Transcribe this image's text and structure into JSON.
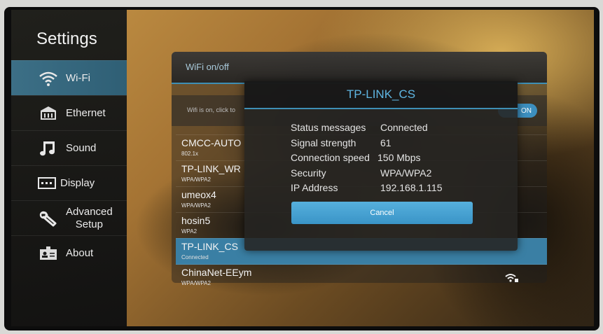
{
  "sidebar": {
    "title": "Settings",
    "items": [
      {
        "label": "Wi-Fi",
        "icon": "wifi-icon",
        "active": true
      },
      {
        "label": "Ethernet",
        "icon": "ethernet-icon"
      },
      {
        "label": "Sound",
        "icon": "music-note-icon"
      },
      {
        "label": "Display",
        "icon": "display-icon"
      },
      {
        "label": "Advanced Setup",
        "line1": "Advanced",
        "line2": "Setup",
        "icon": "wrench-icon"
      },
      {
        "label": "About",
        "icon": "id-card-icon"
      }
    ]
  },
  "wifi_panel": {
    "header": "WiFi on/off",
    "status_text": "Wifi is on, click to",
    "toggle_label": "ON",
    "networks": [
      {
        "name": "CMCC-AUTO",
        "security": "802.1x"
      },
      {
        "name": "TP-LINK_WR",
        "security": "WPA/WPA2"
      },
      {
        "name": "umeox4",
        "security": "WPA/WPA2"
      },
      {
        "name": "hosin5",
        "security": "WPA2"
      },
      {
        "name": "TP-LINK_CS",
        "security": "Connected",
        "connected": true
      },
      {
        "name": "ChinaNet-EEym",
        "security": "WPA/WPA2"
      }
    ]
  },
  "dialog": {
    "title": "TP-LINK_CS",
    "fields": [
      {
        "label": "Status messages",
        "value": "Connected"
      },
      {
        "label": "Signal strength",
        "value": "61"
      },
      {
        "label": "Connection speed",
        "value": "150 Mbps"
      },
      {
        "label": "Security",
        "value": "WPA/WPA2"
      },
      {
        "label": "IP Address",
        "value": "192.168.1.115"
      }
    ],
    "cancel_label": "Cancel"
  },
  "colors": {
    "accent": "#3e8fb5",
    "active_item": "#3c6f86",
    "dialog_title": "#5fb6e2",
    "button": "#4aa3d4"
  }
}
